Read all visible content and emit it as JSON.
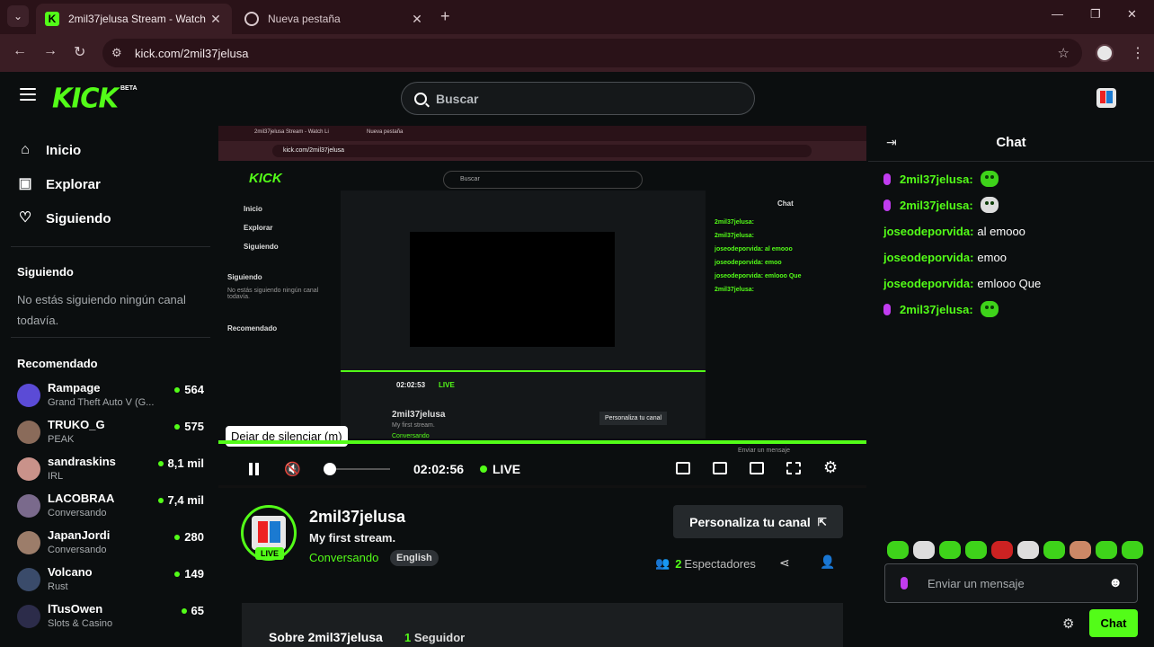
{
  "browser": {
    "tabs": [
      {
        "title": "2mil37jelusa Stream - Watch Li",
        "active": true
      },
      {
        "title": "Nueva pestaña",
        "active": false
      }
    ],
    "url": "kick.com/2mil37jelusa"
  },
  "header": {
    "logo": "KICK",
    "beta": "BETA",
    "search_placeholder": "Buscar"
  },
  "sidebar": {
    "nav": [
      {
        "label": "Inicio",
        "icon": "home-icon"
      },
      {
        "label": "Explorar",
        "icon": "compass-icon"
      },
      {
        "label": "Siguiendo",
        "icon": "heart-icon"
      }
    ],
    "following_title": "Siguiendo",
    "following_empty": "No estás siguiendo ningún canal todavía.",
    "recommended_title": "Recomendado",
    "recommended": [
      {
        "name": "Rampage",
        "category": "Grand Theft Auto V (G...",
        "viewers": "564",
        "color": "#5b4bd6"
      },
      {
        "name": "TRUKO_G",
        "category": "PEAK",
        "viewers": "575",
        "color": "#8a6b5a"
      },
      {
        "name": "sandraskins",
        "category": "IRL",
        "viewers": "8,1 mil",
        "color": "#c9928a"
      },
      {
        "name": "LACOBRAA",
        "category": "Conversando",
        "viewers": "7,4 mil",
        "color": "#7a6a8c"
      },
      {
        "name": "JapanJordi",
        "category": "Conversando",
        "viewers": "280",
        "color": "#9c7d6a"
      },
      {
        "name": "Volcano",
        "category": "Rust",
        "viewers": "149",
        "color": "#3a4b6a"
      },
      {
        "name": "lTusOwen",
        "category": "Slots & Casino",
        "viewers": "65",
        "color": "#2c2c4a"
      }
    ]
  },
  "player": {
    "tooltip": "Dejar de silenciar (m)",
    "time": "02:02:56",
    "live": "LIVE",
    "inner": {
      "tab1": "2mil37jelusa Stream - Watch Li",
      "tab2": "Nueva pestaña",
      "url": "kick.com/2mil37jelusa",
      "search": "Buscar",
      "nav": [
        "Inicio",
        "Explorar",
        "Siguiendo"
      ],
      "following": "Siguiendo",
      "following_empty": "No estás siguiendo ningún canal todavía.",
      "recommended": "Recomendado",
      "time": "02:02:53",
      "live": "LIVE",
      "channel": "2mil37jelusa",
      "stream_title": "My first stream.",
      "category": "Conversando",
      "customize": "Personaliza tu canal",
      "chat_title": "Chat",
      "chat_placeholder": "Enviar un mensaje",
      "chat_msgs": [
        "2mil37jelusa:",
        "2mil37jelusa:",
        "joseodeporvida: al emooo",
        "joseodeporvida: emoo",
        "joseodeporvida: emlooo Que",
        "2mil37jelusa:"
      ]
    }
  },
  "channel": {
    "name": "2mil37jelusa",
    "live_badge": "LIVE",
    "stream_title": "My first stream.",
    "category": "Conversando",
    "language": "English",
    "customize_label": "Personaliza tu canal",
    "viewers_count": "2",
    "viewers_label": "Espectadores",
    "about_title": "Sobre 2mil37jelusa",
    "followers_count": "1",
    "followers_label": "Seguidor"
  },
  "chat": {
    "title": "Chat",
    "messages": [
      {
        "user": "2mil37jelusa:",
        "text": "",
        "mic": true,
        "emote": true
      },
      {
        "user": "2mil37jelusa:",
        "text": "",
        "mic": true,
        "emote": true
      },
      {
        "user": "joseodeporvida:",
        "text": "al emooo",
        "mic": false,
        "emote": false
      },
      {
        "user": "joseodeporvida:",
        "text": "emoo",
        "mic": false,
        "emote": false
      },
      {
        "user": "joseodeporvida:",
        "text": "emlooo Que",
        "mic": false,
        "emote": false
      },
      {
        "user": "2mil37jelusa:",
        "text": "",
        "mic": true,
        "emote": true
      }
    ],
    "input_placeholder": "Enviar un mensaje",
    "send_label": "Chat"
  },
  "colors": {
    "accent": "#53fc18",
    "background": "#0b0e0f",
    "mic": "#c13cf0"
  }
}
